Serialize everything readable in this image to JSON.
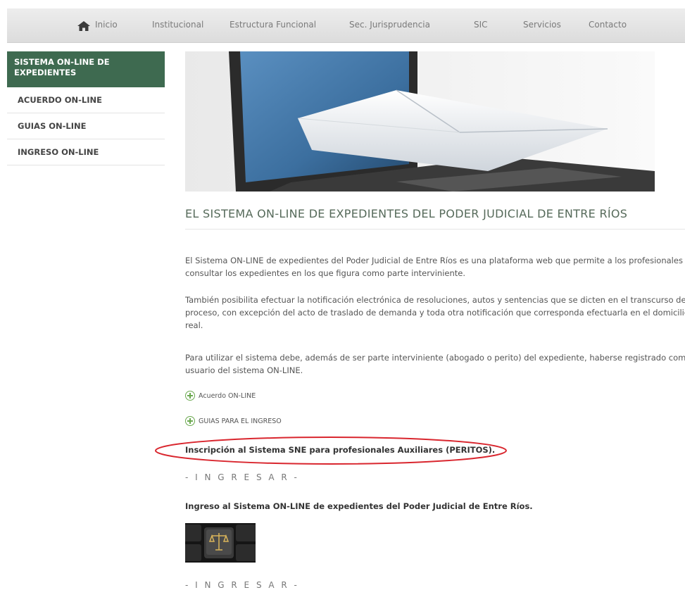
{
  "nav": {
    "items": [
      "Inicio",
      "Institucional",
      "Estructura Funcional",
      "Sec. Jurisprudencia",
      "SIC",
      "Servicios",
      "Contacto"
    ]
  },
  "sidebar": {
    "header": "SISTEMA ON-LINE DE EXPEDIENTES",
    "items": [
      "ACUERDO ON-LINE",
      "GUIAS ON-LINE",
      "INGRESO ON-LINE"
    ]
  },
  "main": {
    "title": "EL SISTEMA ON-LINE DE EXPEDIENTES DEL PODER JUDICIAL DE ENTRE RÍOS",
    "paragraphs": [
      "El Sistema ON-LINE de expedientes del Poder Judicial de Entre Ríos es una plataforma web que permite a los profesionales consultar los expedientes en los que figura como parte interviniente.",
      "También posibilita efectuar la notificación electrónica de resoluciones, autos y sentencias que se dicten en el transcurso del proceso, con excepción del acto de traslado de demanda y toda otra notificación que corresponda efectuarla en el domicilio real.",
      "Para utilizar el sistema debe, además de ser parte interviniente (abogado o perito) del expediente, haberse registrado como usuario del sistema ON-LINE."
    ],
    "links": [
      "Acuerdo ON-LINE",
      "GUIAS PARA EL INGRESO"
    ],
    "peritos_heading": "Inscripción al Sistema SNE para profesionales Auxiliares (PERITOS).",
    "ingresar_1": "- I N G R E S A R -",
    "ingreso_heading": "Ingreso al  Sistema ON-LINE de expedientes del Poder Judicial de Entre Ríos.",
    "ingresar_2": "- I N G R E S A R -"
  },
  "colors": {
    "sidebar_header_bg": "#3e6a50",
    "plus_icon": "#6aa84f",
    "annotation_ellipse": "#d9262e"
  },
  "icons": [
    "home-icon",
    "plus-circle-icon"
  ]
}
